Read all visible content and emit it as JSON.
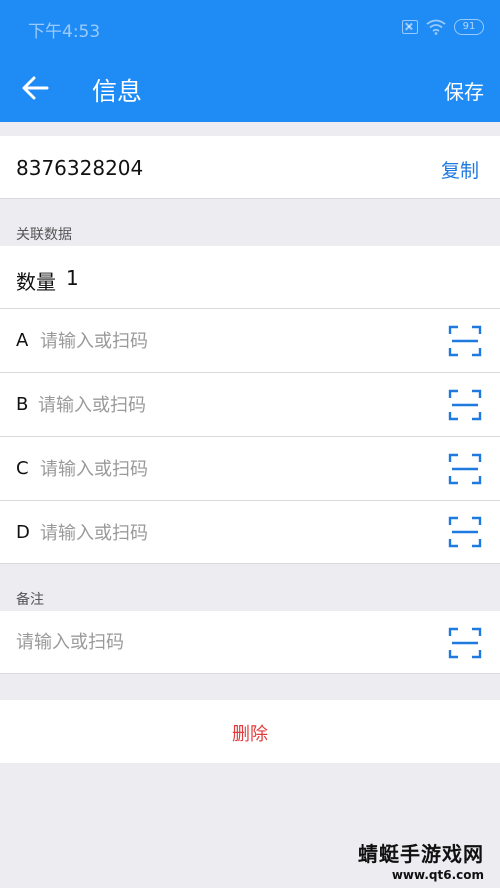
{
  "status_bar": {
    "time": "下午4:53",
    "battery": "91",
    "icons": [
      "sim-off-icon",
      "wifi-icon",
      "battery-icon"
    ]
  },
  "app_bar": {
    "back_icon": "arrow-left-icon",
    "title": "信息",
    "save_label": "保存"
  },
  "code_row": {
    "value": "8376328204",
    "copy_label": "复制"
  },
  "related": {
    "section_label": "关联数据",
    "quantity_label": "数量",
    "quantity_value": "1",
    "fields": [
      {
        "label": "A",
        "placeholder": "请输入或扫码",
        "value": ""
      },
      {
        "label": "B",
        "placeholder": "请输入或扫码",
        "value": ""
      },
      {
        "label": "C",
        "placeholder": "请输入或扫码",
        "value": ""
      },
      {
        "label": "D",
        "placeholder": "请输入或扫码",
        "value": ""
      }
    ]
  },
  "notes": {
    "section_label": "备注",
    "placeholder": "请输入或扫码",
    "value": ""
  },
  "delete_label": "删除",
  "watermark": {
    "title": "蜻蜓手游戏网",
    "url": "www.qt6.com"
  },
  "colors": {
    "primary": "#1f8bf5",
    "link": "#1f7ae0",
    "danger": "#e23b3b",
    "background": "#ececf1"
  }
}
